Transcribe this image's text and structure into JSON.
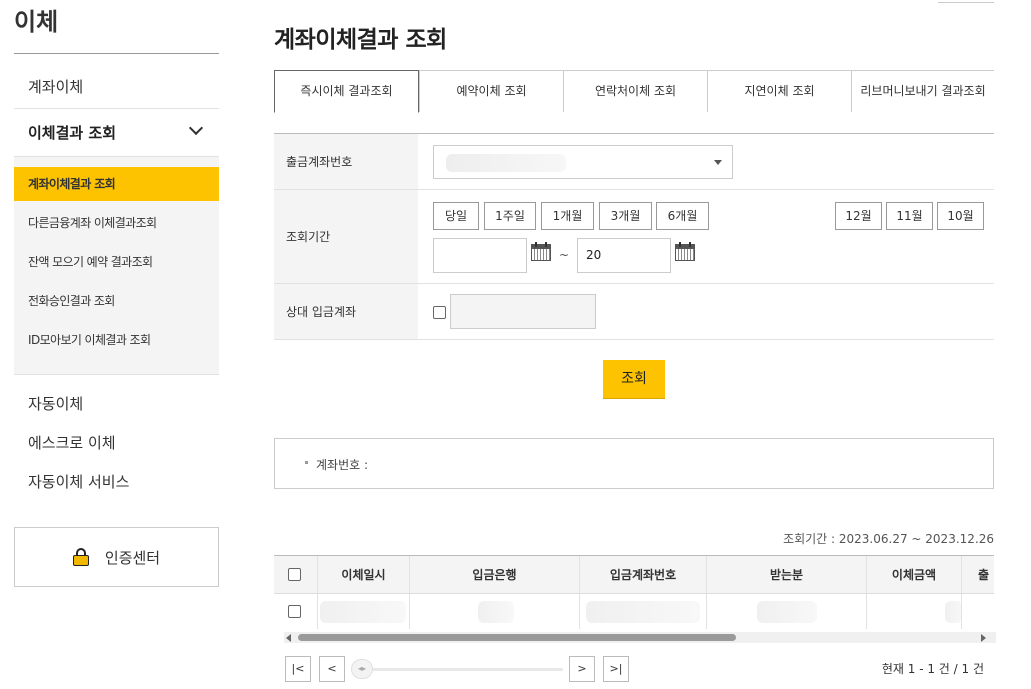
{
  "sidebar": {
    "title": "이체",
    "top_item": "계좌이체",
    "group": {
      "label": "이체결과 조회",
      "items": [
        {
          "label": "계좌이체결과 조회",
          "active": true
        },
        {
          "label": "다른금융계좌 이체결과조회"
        },
        {
          "label": "잔액 모으기 예약 결과조회"
        },
        {
          "label": "전화승인결과 조회"
        },
        {
          "label": "ID모아보기 이체결과 조회"
        }
      ]
    },
    "bottom_items": [
      "자동이체",
      "에스크로 이체",
      "자동이체 서비스"
    ],
    "cert_center": "인증센터"
  },
  "main": {
    "title": "계좌이체결과 조회",
    "tabs": [
      "즉시이체 결과조회",
      "예약이체 조회",
      "연락처이체 조회",
      "지연이체 조회",
      "리브머니보내기 결과조회"
    ],
    "form": {
      "account_label": "출금계좌번호",
      "period_label": "조회기간",
      "period_buttons": [
        "당일",
        "1주일",
        "1개월",
        "3개월",
        "6개월"
      ],
      "month_buttons": [
        "12월",
        "11월",
        "10월"
      ],
      "start_date": "",
      "end_date": "20",
      "date_separator": "~",
      "counterpart_label": "상대 입금계좌"
    },
    "search_button": "조회",
    "info_label": "계좌번호 :",
    "period_text": "조회기간 : 2023.06.27 ~ 2023.12.26",
    "grid": {
      "columns": [
        "",
        "이체일시",
        "입금은행",
        "입금계좌번호",
        "받는분",
        "이체금액",
        "출"
      ]
    },
    "pager": {
      "first": "|<",
      "prev": "<",
      "next": ">",
      "last": ">|",
      "count": "현재 1 - 1 건 / 1 건"
    }
  }
}
